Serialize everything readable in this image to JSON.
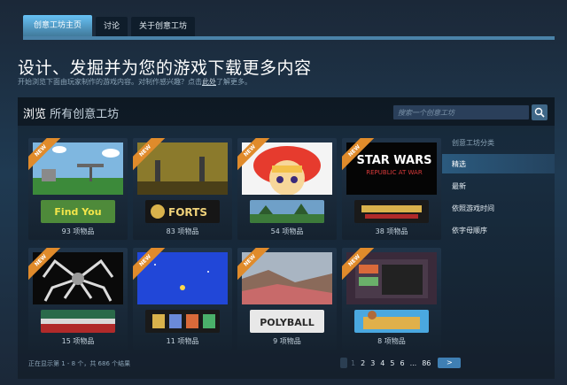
{
  "tabs": [
    "创意工坊主页",
    "讨论",
    "关于创意工坊"
  ],
  "header": {
    "title": "设计、发掘并为您的游戏下载更多内容",
    "subtitle_pre": "开始浏览下面由玩家制作的游戏内容。对制作感兴趣？点击",
    "subtitle_link": "此处",
    "subtitle_post": "了解更多。"
  },
  "panel": {
    "title_main": "浏览",
    "title_sub": "所有创意工坊",
    "search_placeholder": "搜索一个创意工坊"
  },
  "cards": [
    {
      "count": "93 项物品",
      "new": true,
      "ribbon": "NEW",
      "logo_text": "Find You",
      "icon": "find-you-game-card"
    },
    {
      "count": "83 项物品",
      "new": true,
      "ribbon": "NEW",
      "logo_text": "FORTS",
      "icon": "forts-game-card"
    },
    {
      "count": "54 项物品",
      "new": true,
      "ribbon": "NEW",
      "logo_text": "",
      "icon": "anime-game-card"
    },
    {
      "count": "38 项物品",
      "new": true,
      "ribbon": "NEW",
      "logo_text": "STAR WARS",
      "logo_sub": "REPUBLIC AT WAR",
      "icon": "star-wars-game-card"
    },
    {
      "count": "15 项物品",
      "new": true,
      "ribbon": "NEW",
      "logo_text": "",
      "icon": "spider-game-card"
    },
    {
      "count": "11 项物品",
      "new": true,
      "ribbon": "NEW",
      "logo_text": "",
      "icon": "blue-game-card"
    },
    {
      "count": "9 项物品",
      "new": true,
      "ribbon": "NEW",
      "logo_text": "POLYBALL",
      "icon": "polyball-game-card"
    },
    {
      "count": "8 项物品",
      "new": true,
      "ribbon": "NEW",
      "logo_text": "",
      "icon": "party-game-card"
    }
  ],
  "sidebar": {
    "heading": "创意工坊分类",
    "items": [
      "精选",
      "最新",
      "依照游戏时间",
      "依字母顺序"
    ],
    "active_index": 0
  },
  "footer": {
    "status": "正在显示第 1 - 8 个，共 686 个结果",
    "pages": [
      "1",
      "2",
      "3",
      "4",
      "5",
      "6",
      "...",
      "86"
    ],
    "next": ">"
  },
  "colors": {
    "bg": "#1b2838",
    "accent": "#67c1f5",
    "ribbon": "#e08b2b"
  }
}
